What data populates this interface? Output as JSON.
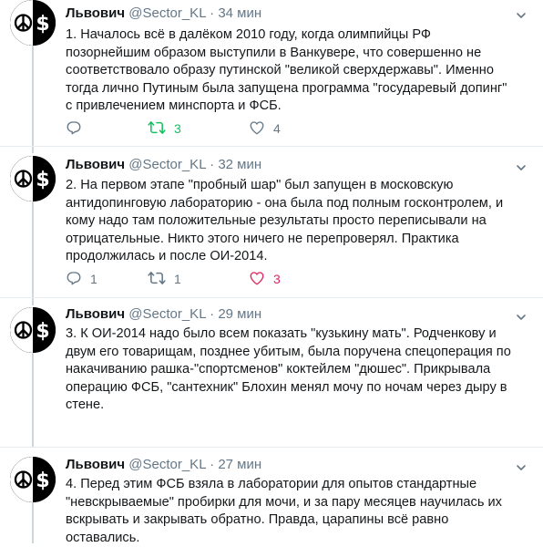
{
  "author": {
    "name": "Львович",
    "handle": "@Sector_KL",
    "sep": "·"
  },
  "tweets": [
    {
      "time": "34 мин",
      "text": "1. Началось всё в далёком 2010 году, когда олимпийцы РФ\nпозорнейшим образом выступили в Ванкувере, что совершенно не\nсоответствовало образу путинской \"великой сверхдержавы\". Именно\nтогда лично Путиным была запущена программа \"государевый допинг\"\nс привлечением минспорта и ФСБ.",
      "replies": "",
      "retweets": "3",
      "likes": "4",
      "retweet_active": true,
      "like_active": false
    },
    {
      "time": "32 мин",
      "text": "2. На первом этапе \"пробный шар\" был запущен в московскую\nантидопинговую лабораторию - она была под полным госконтролем, и\nкому надо там положительные результаты просто переписывали на\nотрицательные. Никто этого ничего не перепроверял. Практика\nпродолжилась и после ОИ-2014.",
      "replies": "1",
      "retweets": "1",
      "likes": "3",
      "retweet_active": false,
      "like_active": true
    },
    {
      "time": "29 мин",
      "text": "3. К ОИ-2014 надо было всем показать \"кузькину мать\". Родченкову и\nдвум его товарищам, позднее убитым, была поручена спецоперация по\nнакачиванию рашка-\"спортсменов\" коктейлем \"дюшес\". Прикрывала\nоперацию ФСБ, \"сантехник\" Блохин менял мочу по ночам через дыру в\nстене.",
      "replies": "",
      "retweets": "",
      "likes": "",
      "retweet_active": false,
      "like_active": false
    },
    {
      "time": "27 мин",
      "text": "4. Перед этим ФСБ взяла в лаборатории для опытов стандартные\n\"невскрываемые\" пробирки для мочи, и за пару месяцев научилась их\nвскрывать и закрывать обратно. Правда, царапины всё равно\nоставались.",
      "replies": "",
      "retweets": "",
      "likes": "",
      "retweet_active": false,
      "like_active": false
    }
  ],
  "colors": {
    "retweet_active": "#17bf63",
    "like_active": "#e0245e",
    "icon": "#657786",
    "thread_line": "#ccd6dd"
  },
  "icons": {
    "avatar": "peace-dollar-avatar",
    "reply": "reply-icon",
    "retweet": "retweet-icon",
    "like": "heart-icon",
    "menu": "chevron-down-icon"
  }
}
